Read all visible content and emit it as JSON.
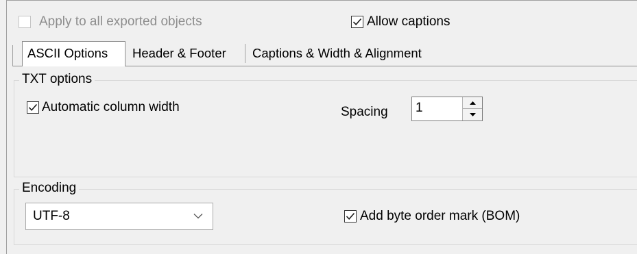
{
  "top_options": {
    "apply_all": {
      "label": "Apply to all exported objects",
      "checked": false,
      "enabled": false
    },
    "allow_captions": {
      "label": "Allow captions",
      "checked": true
    }
  },
  "tabs": [
    {
      "label": "ASCII Options",
      "active": true
    },
    {
      "label": "Header & Footer",
      "active": false
    },
    {
      "label": "Captions & Width & Alignment",
      "active": false
    }
  ],
  "txt_options": {
    "title": "TXT options",
    "auto_column_width": {
      "label": "Automatic column width",
      "checked": true
    },
    "spacing": {
      "label": "Spacing",
      "value": "1"
    }
  },
  "encoding": {
    "title": "Encoding",
    "selected": "UTF-8",
    "add_bom": {
      "label": "Add byte order mark (BOM)",
      "checked": true
    }
  },
  "colors": {
    "background": "#f0f0f0",
    "check": "#1a1a1a",
    "disabled_text": "#8d8d8d"
  },
  "icons": [
    "checkmark-icon",
    "spinner-up-icon",
    "spinner-down-icon",
    "chevron-down-icon"
  ]
}
